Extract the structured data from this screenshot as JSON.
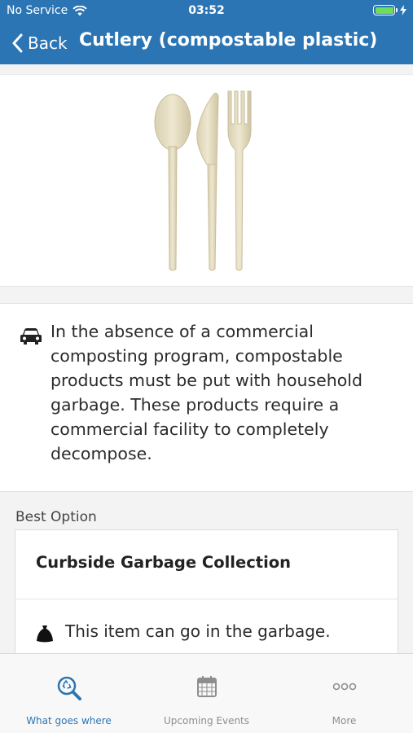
{
  "status_bar": {
    "carrier": "No Service",
    "time": "03:52",
    "wifi_icon": "wifi-icon",
    "battery_icon": "battery-charging-icon",
    "battery_level": 1.0
  },
  "nav": {
    "back_label": "Back",
    "title": "Cutlery (compostable plastic)"
  },
  "item_image": {
    "icon": "compostable-cutlery-image"
  },
  "info": {
    "icon": "car-icon",
    "text": "In the absence of a commercial composting program, compostable products must be put with household garbage. These products require a commercial facility to completely decompose."
  },
  "best_option": {
    "section_label": "Best Option",
    "title": "Curbside Garbage Collection",
    "icon": "garbage-bag-icon",
    "text": "This item can go in the garbage."
  },
  "tabs": [
    {
      "label": "What goes where",
      "icon": "recycle-search-icon",
      "active": true
    },
    {
      "label": "Upcoming Events",
      "icon": "calendar-icon",
      "active": false
    },
    {
      "label": "More",
      "icon": "more-dots-icon",
      "active": false
    }
  ],
  "colors": {
    "brand": "#2b75b4",
    "battery": "#6fdc5a",
    "inactive_tab": "#8e8e8e",
    "background": "#f3f3f3"
  }
}
